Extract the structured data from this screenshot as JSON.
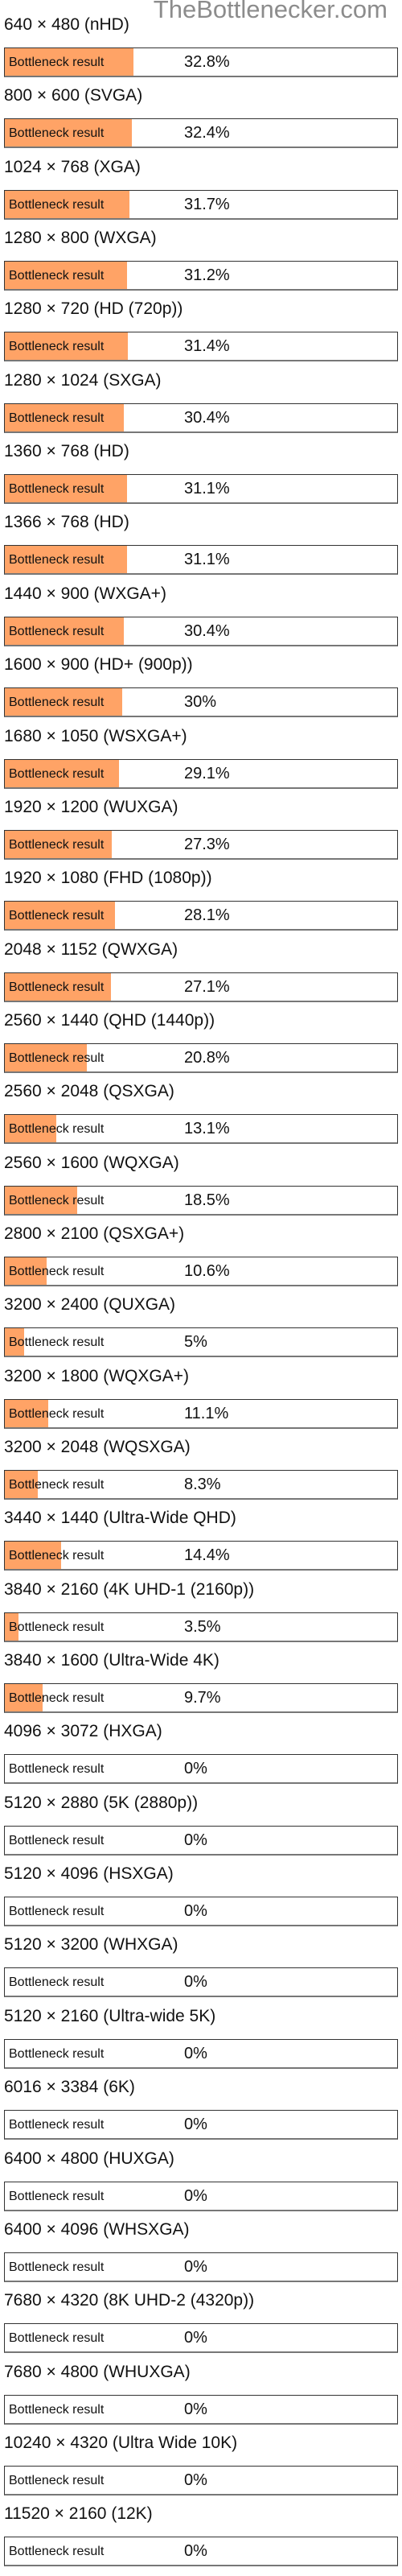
{
  "site_title": "TheBottlenecker.com",
  "bar_label": "Bottleneck result",
  "fill_color": "#ffa366",
  "chart_data": {
    "type": "bar",
    "orientation": "horizontal",
    "title": "",
    "xlabel": "",
    "ylabel": "",
    "xlim": [
      0,
      100
    ],
    "unit": "%",
    "categories": [
      "640 × 480 (nHD)",
      "800 × 600 (SVGA)",
      "1024 × 768 (XGA)",
      "1280 × 800 (WXGA)",
      "1280 × 720 (HD (720p))",
      "1280 × 1024 (SXGA)",
      "1360 × 768 (HD)",
      "1366 × 768 (HD)",
      "1440 × 900 (WXGA+)",
      "1600 × 900 (HD+ (900p))",
      "1680 × 1050 (WSXGA+)",
      "1920 × 1200 (WUXGA)",
      "1920 × 1080 (FHD (1080p))",
      "2048 × 1152 (QWXGA)",
      "2560 × 1440 (QHD (1440p))",
      "2560 × 2048 (QSXGA)",
      "2560 × 1600 (WQXGA)",
      "2800 × 2100 (QSXGA+)",
      "3200 × 2400 (QUXGA)",
      "3200 × 1800 (WQXGA+)",
      "3200 × 2048 (WQSXGA)",
      "3440 × 1440 (Ultra-Wide QHD)",
      "3840 × 2160 (4K UHD-1 (2160p))",
      "3840 × 1600 (Ultra-Wide 4K)",
      "4096 × 3072 (HXGA)",
      "5120 × 2880 (5K (2880p))",
      "5120 × 4096 (HSXGA)",
      "5120 × 3200 (WHXGA)",
      "5120 × 2160 (Ultra-wide 5K)",
      "6016 × 3384 (6K)",
      "6400 × 4800 (HUXGA)",
      "6400 × 4096 (WHSXGA)",
      "7680 × 4320 (8K UHD-2 (4320p))",
      "7680 × 4800 (WHUXGA)",
      "10240 × 4320 (Ultra Wide 10K)",
      "11520 × 2160 (12K)"
    ],
    "values": [
      32.8,
      32.4,
      31.7,
      31.2,
      31.4,
      30.4,
      31.1,
      31.1,
      30.4,
      30,
      29.1,
      27.3,
      28.1,
      27.1,
      20.8,
      13.1,
      18.5,
      10.6,
      5,
      11.1,
      8.3,
      14.4,
      3.5,
      9.7,
      0,
      0,
      0,
      0,
      0,
      0,
      0,
      0,
      0,
      0,
      0,
      0
    ],
    "value_labels": [
      "32.8%",
      "32.4%",
      "31.7%",
      "31.2%",
      "31.4%",
      "30.4%",
      "31.1%",
      "31.1%",
      "30.4%",
      "30%",
      "29.1%",
      "27.3%",
      "28.1%",
      "27.1%",
      "20.8%",
      "13.1%",
      "18.5%",
      "10.6%",
      "5%",
      "11.1%",
      "8.3%",
      "14.4%",
      "3.5%",
      "9.7%",
      "0%",
      "0%",
      "0%",
      "0%",
      "0%",
      "0%",
      "0%",
      "0%",
      "0%",
      "0%",
      "0%",
      "0%"
    ],
    "legend": "none",
    "grid": false
  }
}
